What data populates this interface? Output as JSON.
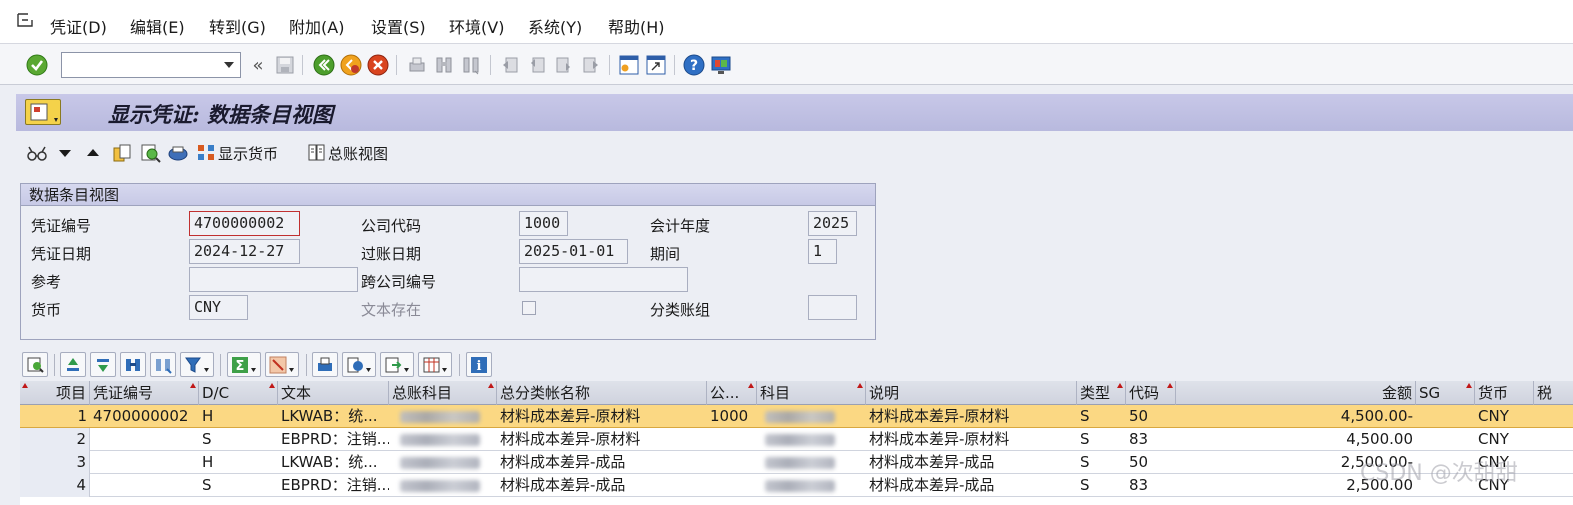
{
  "menu": {
    "items": [
      "凭证(D)",
      "编辑(E)",
      "转到(G)",
      "附加(A)",
      "设置(S)",
      "环境(V)",
      "系统(Y)",
      "帮助(H)"
    ]
  },
  "toolbar": {
    "command_field_value": "",
    "icons": [
      "check-icon",
      "back-arrows-icon",
      "save-icon",
      "back-icon",
      "exit-icon",
      "cancel-icon",
      "print-icon",
      "find-icon",
      "find-next-icon",
      "first-page-icon",
      "prev-page-icon",
      "next-page-icon",
      "last-page-icon",
      "new-session-icon",
      "shortcut-icon",
      "help-icon",
      "customize-layout-icon"
    ]
  },
  "title": {
    "text": "显示凭证: 数据条目视图"
  },
  "app_toolbar": {
    "show_currency_label": "显示货币",
    "ledger_view_label": "总账视图"
  },
  "header_box": {
    "title": "数据条目视图",
    "fields": {
      "doc_number_label": "凭证编号",
      "doc_number_value": "4700000002",
      "company_code_label": "公司代码",
      "company_code_value": "1000",
      "fiscal_year_label": "会计年度",
      "fiscal_year_value": "2025",
      "doc_date_label": "凭证日期",
      "doc_date_value": "2024-12-27",
      "posting_date_label": "过账日期",
      "posting_date_value": "2025-01-01",
      "period_label": "期间",
      "period_value": "1",
      "reference_label": "参考",
      "reference_value": "",
      "cross_company_label": "跨公司编号",
      "cross_company_value": "",
      "currency_label": "货币",
      "currency_value": "CNY",
      "text_exists_label": "文本存在",
      "ledger_group_label": "分类账组",
      "ledger_group_value": ""
    }
  },
  "grid": {
    "columns": [
      "项目",
      "凭证编号",
      "D/C",
      "文本",
      "总账科目",
      "总分类帐名称",
      "公...",
      "科目",
      "说明",
      "类型",
      "代码",
      "金额",
      "SG",
      "货币",
      "税"
    ],
    "rows": [
      {
        "item": "1",
        "doc": "4700000002",
        "dc": "H",
        "text": "LKWAB：统...",
        "gl": "",
        "gl_name": "材料成本差异-原材料",
        "co": "1000",
        "account": "",
        "desc": "材料成本差异-原材料",
        "type": "S",
        "code": "50",
        "amount": "4,500.00-",
        "sg": "",
        "currency": "CNY",
        "tax": ""
      },
      {
        "item": "2",
        "doc": "",
        "dc": "S",
        "text": "EBPRD：注销...",
        "gl": "",
        "gl_name": "材料成本差异-原材料",
        "co": "",
        "account": "",
        "desc": "材料成本差异-原材料",
        "type": "S",
        "code": "83",
        "amount": "4,500.00",
        "sg": "",
        "currency": "CNY",
        "tax": ""
      },
      {
        "item": "3",
        "doc": "",
        "dc": "H",
        "text": "LKWAB：统...",
        "gl": "",
        "gl_name": "材料成本差异-成品",
        "co": "",
        "account": "",
        "desc": "材料成本差异-成品",
        "type": "S",
        "code": "50",
        "amount": "2,500.00-",
        "sg": "",
        "currency": "CNY",
        "tax": ""
      },
      {
        "item": "4",
        "doc": "",
        "dc": "S",
        "text": "EBPRD：注销...",
        "gl": "",
        "gl_name": "材料成本差异-成品",
        "co": "",
        "account": "",
        "desc": "材料成本差异-成品",
        "type": "S",
        "code": "83",
        "amount": "2,500.00",
        "sg": "",
        "currency": "CNY",
        "tax": ""
      }
    ]
  },
  "watermark": "CSDN @次甜甜",
  "colors": {
    "title_bg": "#b8b9de",
    "selected_row": "#fbd883",
    "sort_marker": "#c01818"
  }
}
